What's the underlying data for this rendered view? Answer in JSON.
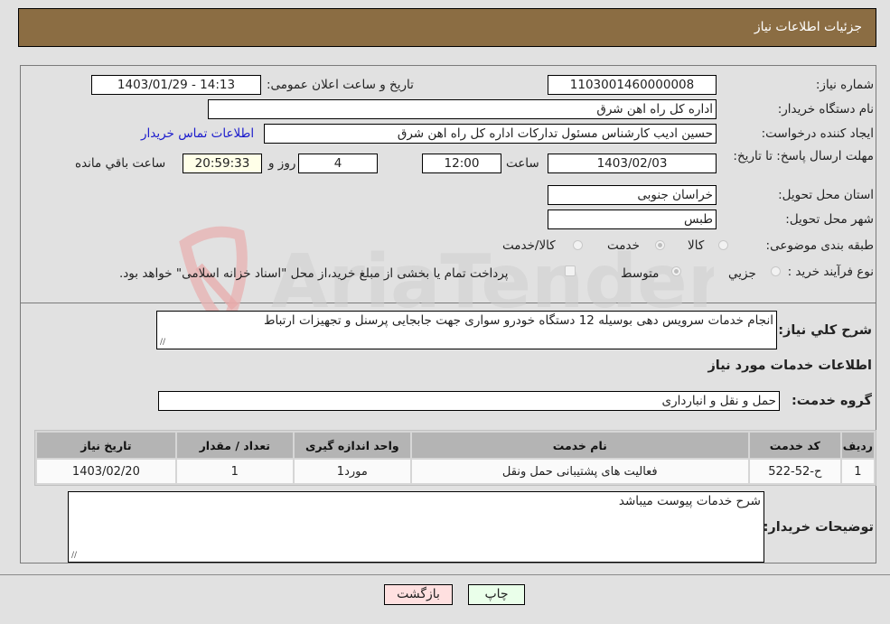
{
  "header": {
    "title": "جزئیات اطلاعات نیاز"
  },
  "fields": {
    "need_number_label": "شماره نیاز:",
    "need_number": "1103001460000008",
    "announce_label": "تاریخ و ساعت اعلان عمومی:",
    "announce_value": "1403/01/29 - 14:13",
    "buyer_org_label": "نام دستگاه خریدار:",
    "buyer_org": "اداره کل راه اهن شرق",
    "requester_label": "ایجاد کننده درخواست:",
    "requester": "حسین ادیب کارشناس مسئول تدارکات اداره کل راه اهن شرق",
    "buyer_contact_link": "اطلاعات تماس خریدار",
    "deadline_label": "مهلت ارسال پاسخ: تا تاریخ:",
    "deadline_date": "1403/02/03",
    "time_label": "ساعت",
    "deadline_time": "12:00",
    "days_value": "4",
    "days_label": "روز و",
    "remaining_time": "20:59:33",
    "remaining_label": "ساعت باقي مانده",
    "province_label": "استان محل تحویل:",
    "province": "خراسان جنوبی",
    "city_label": "شهر محل تحویل:",
    "city": "طبس",
    "category_label": "طبقه بندی موضوعی:",
    "category_options": [
      {
        "label": "کالا",
        "selected": false
      },
      {
        "label": "خدمت",
        "selected": true
      },
      {
        "label": "کالا/خدمت",
        "selected": false
      }
    ],
    "process_label": "نوع فرآیند خرید :",
    "process_options": [
      {
        "label": "جزیي",
        "selected": false
      },
      {
        "label": "متوسط",
        "selected": true
      }
    ],
    "treasury_note": "پرداخت تمام یا بخشی از مبلغ خرید،از محل \"اسناد خزانه اسلامی\" خواهد بود.",
    "treasury_checked": false
  },
  "description": {
    "label": "شرح کلي نیاز:",
    "value": "انجام خدمات سرویس دهی بوسیله 12 دستگاه خودرو سواری جهت جابجایی پرسنل و تجهیزات ارتباط"
  },
  "services_section": {
    "title": "اطلاعات خدمات مورد نیاز",
    "group_label": "گروه خدمت:",
    "group_value": "حمل و نقل و انبارداری"
  },
  "table": {
    "columns": [
      "ردیف",
      "کد خدمت",
      "نام خدمت",
      "واحد اندازه گیری",
      "تعداد / مقدار",
      "تاریخ نیاز"
    ],
    "rows": [
      [
        "1",
        "ح-52-522",
        "فعالیت های پشتیبانی حمل ونقل",
        "مورد1",
        "1",
        "1403/02/20"
      ]
    ]
  },
  "buyer_notes": {
    "label": "توضیحات خریدار:",
    "value": "شرح خدمات پیوست میباشد"
  },
  "buttons": {
    "print": "چاپ",
    "back": "بازگشت"
  },
  "colors": {
    "header_bg": "#8b6d43",
    "back_button_bg": "#ffe0e0",
    "print_button_bg": "#eaffea",
    "link": "#1a1acc"
  }
}
